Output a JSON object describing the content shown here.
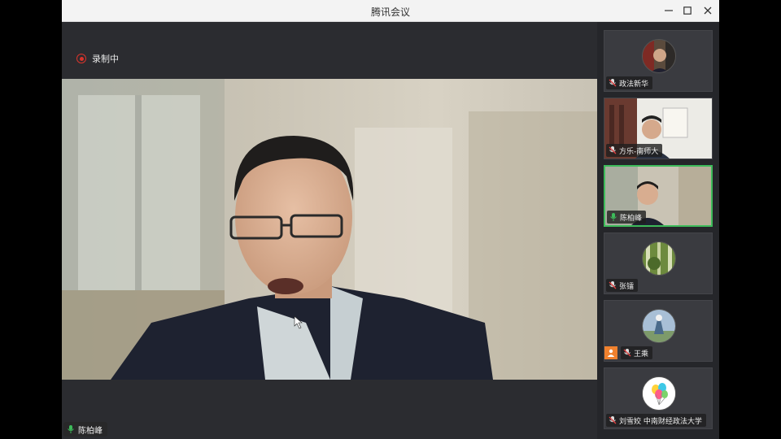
{
  "window": {
    "title": "腾讯会议"
  },
  "recording": {
    "label": "录制中"
  },
  "main_speaker": {
    "name": "陈柏峰"
  },
  "participants": [
    {
      "name": "政法新华",
      "kind": "avatar"
    },
    {
      "name": "方乐-南师大",
      "kind": "video"
    },
    {
      "name": "陈柏峰",
      "kind": "video",
      "speaking": true
    },
    {
      "name": "张镭",
      "kind": "avatar"
    },
    {
      "name": "王乘",
      "kind": "avatar",
      "host": true
    },
    {
      "name": "刘雪姣 中南财经政法大学",
      "kind": "avatar"
    }
  ],
  "colors": {
    "recording": "#d9342b",
    "speaking": "#3dbb5a",
    "host": "#f0812e"
  }
}
